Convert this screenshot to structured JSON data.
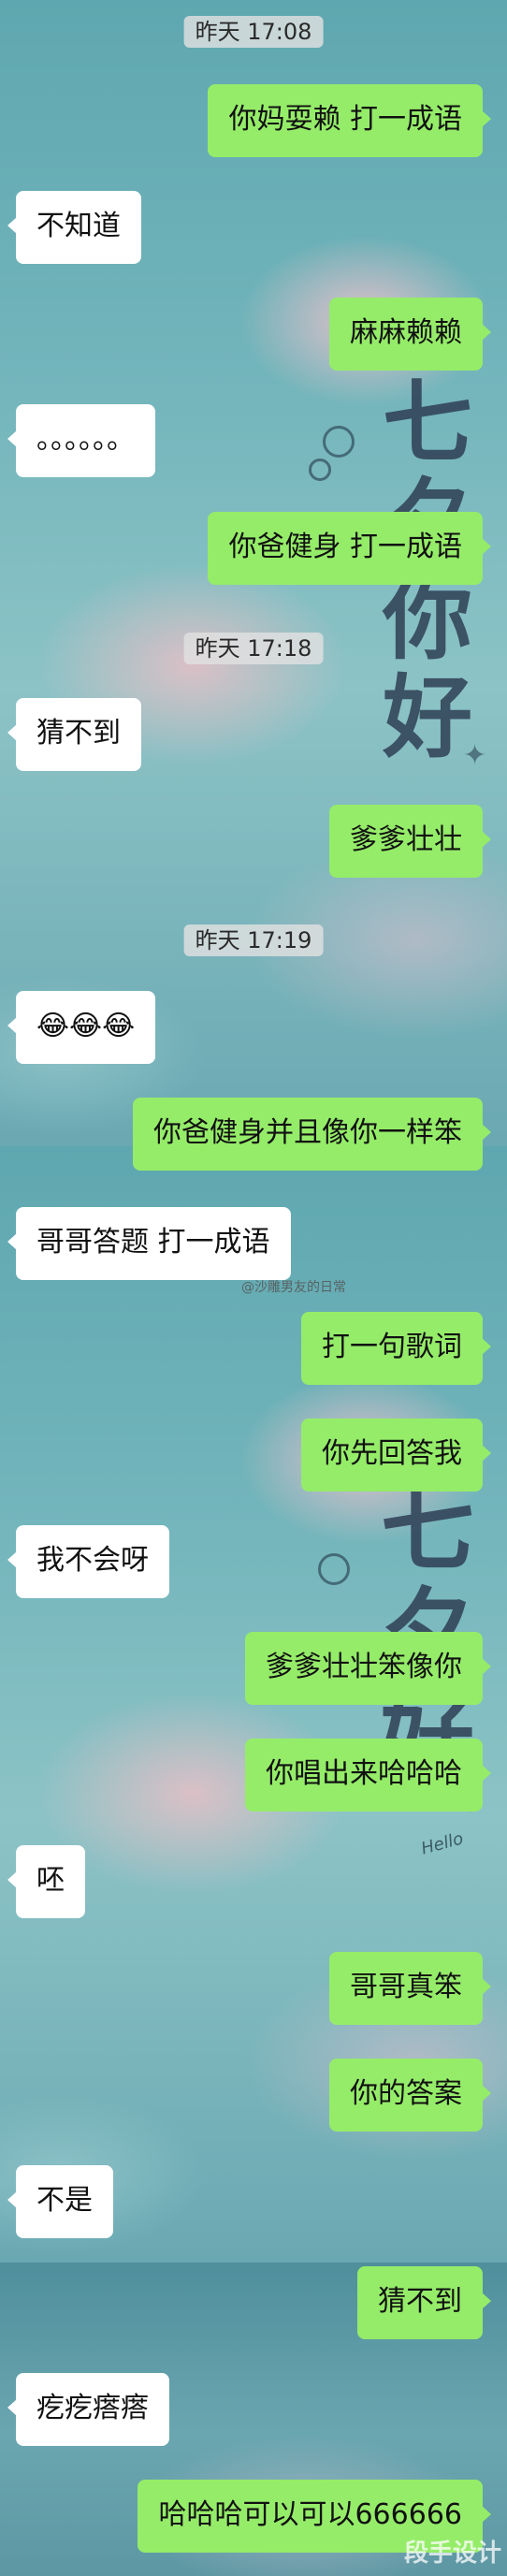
{
  "timestamps": [
    "昨天 17:08",
    "昨天 17:18",
    "昨天 17:19"
  ],
  "messages": [
    {
      "side": "right",
      "text": "你妈耍赖 打一成语"
    },
    {
      "side": "left",
      "text": "不知道"
    },
    {
      "side": "right",
      "text": "麻麻赖赖"
    },
    {
      "side": "left",
      "text": "。。。。。。"
    },
    {
      "side": "right",
      "text": "你爸健身 打一成语"
    },
    {
      "side": "left",
      "text": "猜不到"
    },
    {
      "side": "right",
      "text": "爹爹壮壮"
    },
    {
      "side": "left",
      "text": "😂😂😂"
    },
    {
      "side": "right",
      "text": "你爸健身并且像你一样笨"
    },
    {
      "side": "left",
      "text": "哥哥答题 打一成语"
    },
    {
      "side": "right",
      "text": "打一句歌词"
    },
    {
      "side": "right",
      "text": "你先回答我"
    },
    {
      "side": "left",
      "text": "我不会呀"
    },
    {
      "side": "right",
      "text": "爹爹壮壮笨像你"
    },
    {
      "side": "right",
      "text": "你唱出来哈哈哈"
    },
    {
      "side": "left",
      "text": "呸"
    },
    {
      "side": "right",
      "text": "哥哥真笨"
    },
    {
      "side": "right",
      "text": "你的答案"
    },
    {
      "side": "left",
      "text": "不是"
    },
    {
      "side": "right",
      "text": "猜不到"
    },
    {
      "side": "left",
      "text": "疙疙瘩瘩"
    },
    {
      "side": "right",
      "text": "哈哈哈可以可以666666"
    }
  ],
  "wallpaper": {
    "title_top": "七夕你好",
    "title_bottom": "七夕好",
    "script_text": "Hello"
  },
  "watermark": "@沙雕男友的日常",
  "corner_mark": "段手设计",
  "colors": {
    "bubble_right": "#95ec69",
    "bubble_left": "#ffffff",
    "timestamp_bg": "#e1e1e1"
  }
}
